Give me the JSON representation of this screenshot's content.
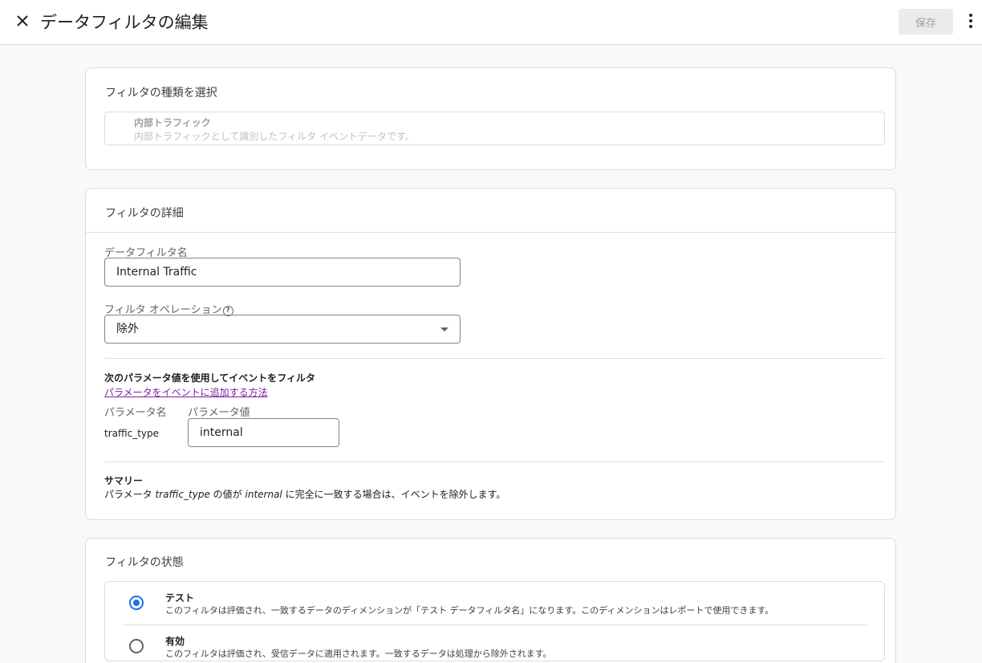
{
  "header": {
    "title": "データフィルタの編集",
    "save_label": "保存",
    "close_icon": "close-icon",
    "more_icon": "more-vert-icon"
  },
  "filter_type": {
    "section_title": "フィルタの種類を選択",
    "selected_name": "内部トラフィック",
    "selected_desc": "内部トラフィックとして識別したフィルタ イベントデータです。"
  },
  "details": {
    "section_title": "フィルタの詳細",
    "name_label": "データフィルタ名",
    "name_value": "Internal Traffic",
    "operation_label": "フィルタ オペレーション",
    "operation_help_icon": "help-icon",
    "operation_value": "除外",
    "param_heading": "次のパラメータ値を使用してイベントをフィルタ",
    "param_link": "パラメータをイベントに追加する方法",
    "param_name_col": "パラメータ名",
    "param_value_col": "パラメータ値",
    "param_name": "traffic_type",
    "param_value": "internal",
    "summary_heading": "サマリー",
    "summary_pre": "パラメータ ",
    "summary_param": "traffic_type",
    "summary_mid": " の値が ",
    "summary_value": "internal",
    "summary_post": " に完全に一致する場合は、イベントを除外します。"
  },
  "status": {
    "section_title": "フィルタの状態",
    "options": [
      {
        "title": "テスト",
        "desc": "このフィルタは評価され、一致するデータのディメンションが「テスト データフィルタ名」になります。このディメンションはレポートで使用できます。",
        "selected": true
      },
      {
        "title": "有効",
        "desc": "このフィルタは評価され、受信データに適用されます。一致するデータは処理から除外されます。",
        "selected": false
      }
    ]
  },
  "colors": {
    "accent": "#1a73e8",
    "link": "#7b1fa2"
  }
}
